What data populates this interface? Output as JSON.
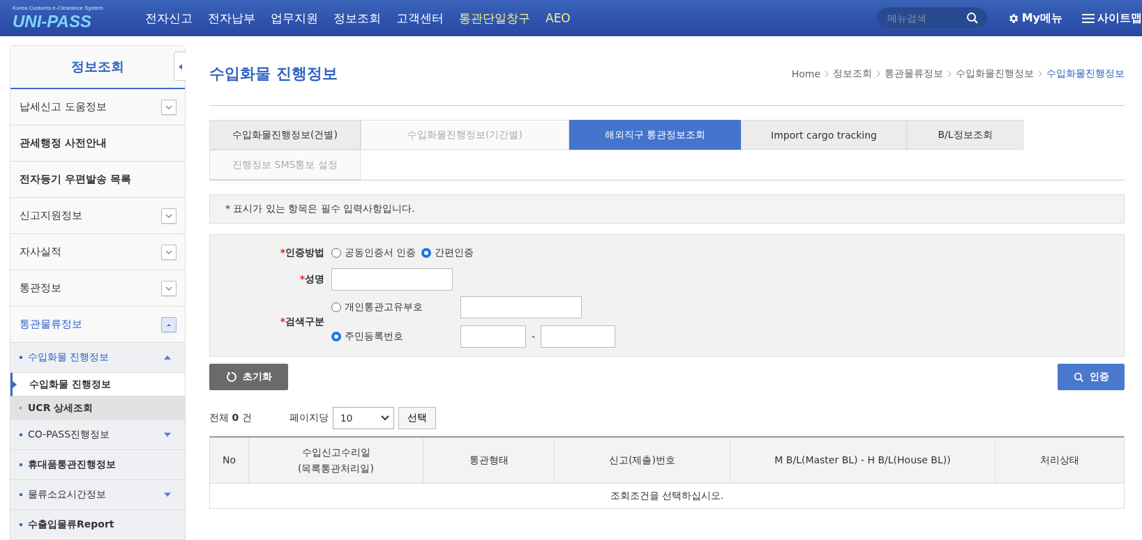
{
  "header": {
    "logo_caption": "Korea Customs e-Clearance System",
    "logo": "UNI-PASS",
    "nav": [
      {
        "label": "전자신고",
        "accent": false
      },
      {
        "label": "전자납부",
        "accent": false
      },
      {
        "label": "업무지원",
        "accent": false
      },
      {
        "label": "정보조회",
        "accent": false
      },
      {
        "label": "고객센터",
        "accent": false
      },
      {
        "label": "통관단일창구",
        "accent": true
      },
      {
        "label": "AEO",
        "accent": true
      }
    ],
    "search": {
      "placeholder": "메뉴검색"
    },
    "my_menu": "My메뉴",
    "sitemap": "사이트맵"
  },
  "sidebar": {
    "title": "정보조회",
    "items": [
      {
        "label": "납세신고 도움정보",
        "kind": "toggle",
        "bold": false,
        "expanded": false
      },
      {
        "label": "관세행정 사전안내",
        "kind": "link",
        "bold": true
      },
      {
        "label": "전자등기 우편발송 목록",
        "kind": "link",
        "bold": true
      },
      {
        "label": "신고지원정보",
        "kind": "toggle",
        "bold": false,
        "expanded": false
      },
      {
        "label": "자사실적",
        "kind": "toggle",
        "bold": false,
        "expanded": false
      },
      {
        "label": "통관정보",
        "kind": "toggle",
        "bold": false,
        "expanded": false
      },
      {
        "label": "통관물류정보",
        "kind": "toggle",
        "bold": false,
        "expanded": true,
        "children": [
          {
            "label": "수입화물 진행정보",
            "kind": "toggle",
            "bold": false,
            "expanded": true,
            "children": [
              {
                "label": "수입화물 진행정보",
                "selected": true
              }
            ]
          },
          {
            "label": "UCR 상세조회",
            "kind": "leaf",
            "bold": true
          },
          {
            "label": "CO-PASS진행정보",
            "kind": "toggle",
            "bold": false,
            "expanded": false
          },
          {
            "label": "휴대품통관진행정보",
            "kind": "link",
            "bold": true
          },
          {
            "label": "물류소요시간정보",
            "kind": "toggle",
            "bold": false,
            "expanded": false
          },
          {
            "label": "수출입물류Report",
            "kind": "link",
            "bold": true
          }
        ]
      }
    ]
  },
  "page": {
    "title": "수입화물 진행정보",
    "breadcrumb": [
      "Home",
      "정보조회",
      "통관물류정보",
      "수입화물진행정보",
      "수입화물진행정보"
    ],
    "tabs": [
      {
        "label": "수입화물진행정보(건별)",
        "selected": false,
        "disabled": false
      },
      {
        "label": "수입화물진행정보(기간별)",
        "selected": false,
        "disabled": true
      },
      {
        "label": "해외직구 통관정보조회",
        "selected": true,
        "disabled": false
      },
      {
        "label": "Import cargo tracking",
        "selected": false,
        "disabled": false
      },
      {
        "label": "B/L정보조회",
        "selected": false,
        "disabled": false
      },
      {
        "label": "진행정보 SMS통보 설정",
        "selected": false,
        "disabled": true
      }
    ],
    "notice": "* 표시가 있는 항목은 필수 입력사항입니다.",
    "form": {
      "auth_method": {
        "required_mark": "*",
        "label": "인증방법",
        "options": [
          {
            "label": "공동인증서 인증",
            "selected": false
          },
          {
            "label": "간편인증",
            "selected": true
          }
        ]
      },
      "name": {
        "required_mark": "*",
        "label": "성명"
      },
      "search_type": {
        "required_mark": "*",
        "label": "검색구분",
        "options": [
          {
            "label": "개인통관고유부호",
            "selected": false
          },
          {
            "label": "주민등록번호",
            "selected": true
          }
        ],
        "separator": "-"
      }
    },
    "reset_button": "초기화",
    "auth_button": "인증",
    "count": {
      "prefix": "전체",
      "value": "0",
      "suffix": "건"
    },
    "per_page": {
      "label": "페이지당",
      "value": "10",
      "button": "선택"
    },
    "table": {
      "columns": [
        "No",
        "수입신고수리일\n(목록통관처리일)",
        "통관형태",
        "신고(제출)번호",
        "M B/L(Master BL) - H B/L(House BL))",
        "처리상태"
      ],
      "empty": "조회조건을 선택하십시오."
    }
  }
}
